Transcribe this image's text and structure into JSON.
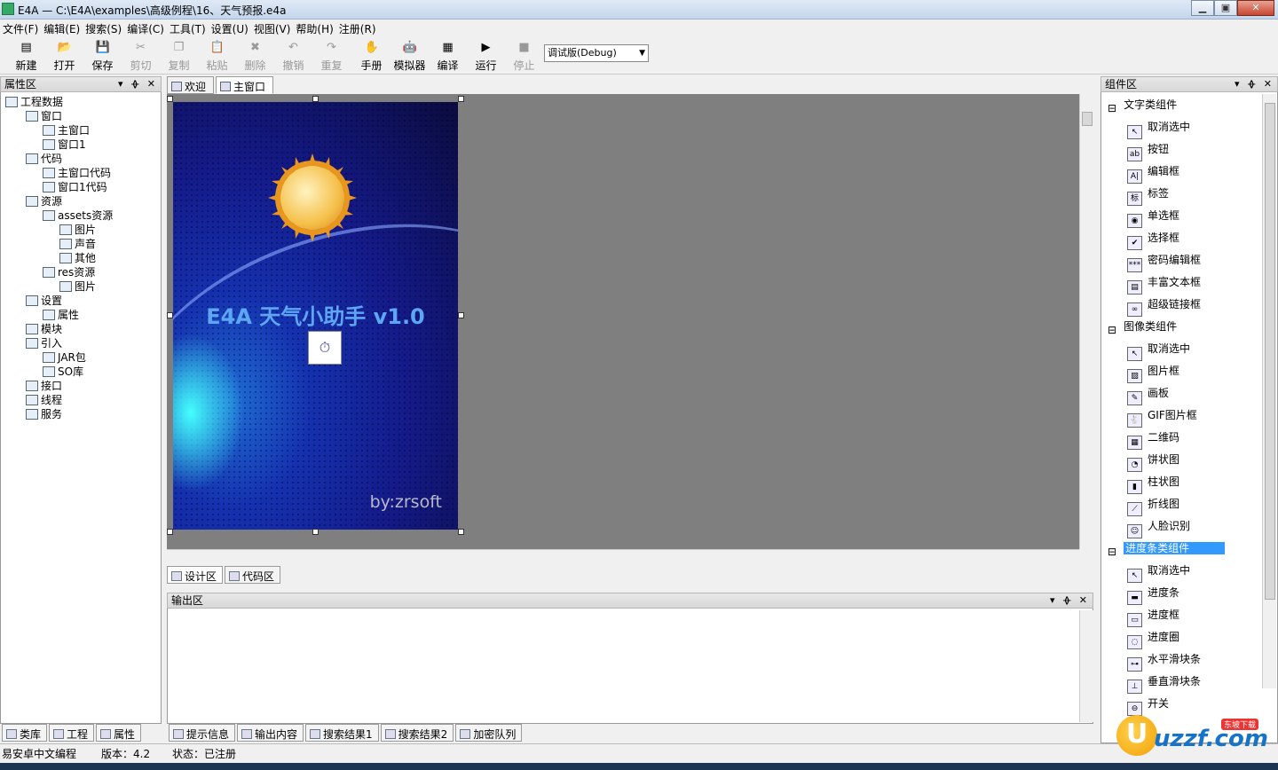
{
  "window": {
    "title": "E4A — C:\\E4A\\examples\\高级例程\\16、天气预报.e4a",
    "min": "▁",
    "max": "▣",
    "close": "✕"
  },
  "menu": [
    "文件(F)",
    "编辑(E)",
    "搜索(S)",
    "编译(C)",
    "工具(T)",
    "设置(U)",
    "视图(V)",
    "帮助(H)",
    "注册(R)"
  ],
  "toolbar": [
    {
      "label": "新建",
      "icon": "new-icon",
      "glyph": "▤",
      "disabled": false
    },
    {
      "label": "打开",
      "icon": "open-icon",
      "glyph": "📂",
      "disabled": false
    },
    {
      "label": "保存",
      "icon": "save-icon",
      "glyph": "💾",
      "disabled": false
    },
    {
      "label": "剪切",
      "icon": "cut-icon",
      "glyph": "✂",
      "disabled": true
    },
    {
      "label": "复制",
      "icon": "copy-icon",
      "glyph": "❐",
      "disabled": true
    },
    {
      "label": "粘贴",
      "icon": "paste-icon",
      "glyph": "📋",
      "disabled": true
    },
    {
      "label": "删除",
      "icon": "delete-icon",
      "glyph": "✖",
      "disabled": true
    },
    {
      "label": "撤销",
      "icon": "undo-icon",
      "glyph": "↶",
      "disabled": true
    },
    {
      "label": "重复",
      "icon": "redo-icon",
      "glyph": "↷",
      "disabled": true
    },
    {
      "label": "手册",
      "icon": "manual-icon",
      "glyph": "✋",
      "disabled": false
    },
    {
      "label": "模拟器",
      "icon": "android-icon",
      "glyph": "🤖",
      "disabled": false
    },
    {
      "label": "编译",
      "icon": "compile-icon",
      "glyph": "▦",
      "disabled": false
    },
    {
      "label": "运行",
      "icon": "run-icon",
      "glyph": "▶",
      "disabled": false
    },
    {
      "label": "停止",
      "icon": "stop-icon",
      "glyph": "■",
      "disabled": true
    }
  ],
  "build_mode": "调试版(Debug)",
  "left_panel": {
    "title": "属性区",
    "controls": "▾ ᚖ ✕",
    "tree": [
      {
        "label": "工程数据",
        "depth": 0,
        "exp": ""
      },
      {
        "label": "窗口",
        "depth": 1,
        "exp": "−"
      },
      {
        "label": "主窗口",
        "depth": 2,
        "exp": ""
      },
      {
        "label": "窗口1",
        "depth": 2,
        "exp": ""
      },
      {
        "label": "代码",
        "depth": 1,
        "exp": "−"
      },
      {
        "label": "主窗口代码",
        "depth": 2,
        "exp": ""
      },
      {
        "label": "窗口1代码",
        "depth": 2,
        "exp": ""
      },
      {
        "label": "资源",
        "depth": 1,
        "exp": "−"
      },
      {
        "label": "assets资源",
        "depth": 2,
        "exp": "−"
      },
      {
        "label": "图片",
        "depth": 3,
        "exp": ""
      },
      {
        "label": "声音",
        "depth": 3,
        "exp": ""
      },
      {
        "label": "其他",
        "depth": 3,
        "exp": ""
      },
      {
        "label": "res资源",
        "depth": 2,
        "exp": "−"
      },
      {
        "label": "图片",
        "depth": 3,
        "exp": ""
      },
      {
        "label": "设置",
        "depth": 1,
        "exp": "−"
      },
      {
        "label": "属性",
        "depth": 2,
        "exp": ""
      },
      {
        "label": "模块",
        "depth": 1,
        "exp": "+"
      },
      {
        "label": "引入",
        "depth": 1,
        "exp": "−"
      },
      {
        "label": "JAR包",
        "depth": 2,
        "exp": ""
      },
      {
        "label": "SO库",
        "depth": 2,
        "exp": ""
      },
      {
        "label": "接口",
        "depth": 1,
        "exp": ""
      },
      {
        "label": "线程",
        "depth": 1,
        "exp": ""
      },
      {
        "label": "服务",
        "depth": 1,
        "exp": ""
      }
    ],
    "tabs": [
      "类库",
      "工程",
      "属性"
    ]
  },
  "doc_tabs": [
    "欢迎",
    "主窗口"
  ],
  "phone": {
    "title": "E4A 天气小助手 v1.0",
    "by": "by:zrsoft"
  },
  "design_tabs": [
    "设计区",
    "代码区"
  ],
  "output": {
    "title": "输出区",
    "tabs": [
      "提示信息",
      "输出内容",
      "搜索结果1",
      "搜索结果2",
      "加密队列"
    ]
  },
  "right_panel": {
    "title": "组件区",
    "items": [
      {
        "label": "文字类组件",
        "type": "group",
        "glyph": "⊟"
      },
      {
        "label": "取消选中",
        "type": "item",
        "glyph": "↖",
        "icon": "pointer-icon"
      },
      {
        "label": "按钮",
        "type": "item",
        "glyph": "ab",
        "icon": "button-icon"
      },
      {
        "label": "编辑框",
        "type": "item",
        "glyph": "A|",
        "icon": "editbox-icon"
      },
      {
        "label": "标签",
        "type": "item",
        "glyph": "标",
        "icon": "label-icon"
      },
      {
        "label": "单选框",
        "type": "item",
        "glyph": "◉",
        "icon": "radio-icon"
      },
      {
        "label": "选择框",
        "type": "item",
        "glyph": "✔",
        "icon": "checkbox-icon"
      },
      {
        "label": "密码编辑框",
        "type": "item",
        "glyph": "***",
        "icon": "password-icon"
      },
      {
        "label": "丰富文本框",
        "type": "item",
        "glyph": "▤",
        "icon": "richtext-icon"
      },
      {
        "label": "超级链接框",
        "type": "item",
        "glyph": "∞",
        "icon": "link-icon"
      },
      {
        "label": "图像类组件",
        "type": "group",
        "glyph": "⊟"
      },
      {
        "label": "取消选中",
        "type": "item",
        "glyph": "↖",
        "icon": "pointer-icon"
      },
      {
        "label": "图片框",
        "type": "item",
        "glyph": "▨",
        "icon": "picture-icon"
      },
      {
        "label": "画板",
        "type": "item",
        "glyph": "✎",
        "icon": "canvas-icon"
      },
      {
        "label": "GIF图片框",
        "type": "item",
        "glyph": "🐇",
        "icon": "gif-icon"
      },
      {
        "label": "二维码",
        "type": "item",
        "glyph": "▦",
        "icon": "qrcode-icon"
      },
      {
        "label": "饼状图",
        "type": "item",
        "glyph": "◔",
        "icon": "piechart-icon"
      },
      {
        "label": "柱状图",
        "type": "item",
        "glyph": "▮",
        "icon": "barchart-icon"
      },
      {
        "label": "折线图",
        "type": "item",
        "glyph": "⟋",
        "icon": "linechart-icon"
      },
      {
        "label": "人脸识别",
        "type": "item",
        "glyph": "☺",
        "icon": "face-icon"
      },
      {
        "label": "进度条类组件",
        "type": "group",
        "glyph": "⊟",
        "selected": true
      },
      {
        "label": "取消选中",
        "type": "item",
        "glyph": "↖",
        "icon": "pointer-icon"
      },
      {
        "label": "进度条",
        "type": "item",
        "glyph": "▬",
        "icon": "progressbar-icon"
      },
      {
        "label": "进度框",
        "type": "item",
        "glyph": "▭",
        "icon": "progressbox-icon"
      },
      {
        "label": "进度圈",
        "type": "item",
        "glyph": "◌",
        "icon": "progressring-icon"
      },
      {
        "label": "水平滑块条",
        "type": "item",
        "glyph": "⊶",
        "icon": "hslider-icon"
      },
      {
        "label": "垂直滑块条",
        "type": "item",
        "glyph": "⊥",
        "icon": "vslider-icon"
      },
      {
        "label": "开关",
        "type": "item",
        "glyph": "⊖",
        "icon": "switch-icon"
      }
    ]
  },
  "status": {
    "app": "易安卓中文编程",
    "version": "版本：4.2",
    "state": "状态：已注册"
  },
  "watermark": {
    "letter": "U",
    "text": "uzzf.com",
    "tag": "东坡下载"
  }
}
